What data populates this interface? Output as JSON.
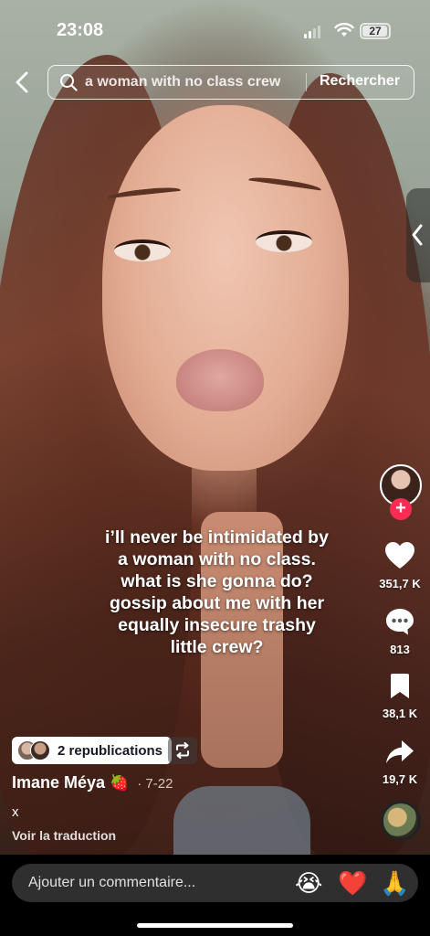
{
  "status_bar": {
    "time": "23:08",
    "battery": "27"
  },
  "search": {
    "query": "a woman with no class crew",
    "button_label": "Rechercher"
  },
  "video": {
    "caption_lines": [
      "i’ll never be intimidated by",
      "a woman with no class.",
      "what is she gonna do?",
      "gossip about me with her",
      "equally insecure trashy",
      "little crew?"
    ]
  },
  "actions": {
    "like_count": "351,7 K",
    "comment_count": "813",
    "save_count": "38,1 K",
    "share_count": "19,7 K",
    "like_color": "#ffffff",
    "follow_color": "#fe2c55"
  },
  "post": {
    "republications_label": "2 republications",
    "author": "Imane Méya",
    "author_emoji": "🍓",
    "date": "· 7-22",
    "description": "x",
    "translate_label": "Voir la traduction"
  },
  "comment_bar": {
    "placeholder": "Ajouter un commentaire...",
    "emojis": [
      "😭",
      "❤️",
      "🙏"
    ]
  },
  "icons": [
    "back-chevron-icon",
    "search-icon",
    "heart-icon",
    "comment-icon",
    "bookmark-icon",
    "share-icon",
    "repost-icon",
    "plus-icon",
    "panel-chevron-icon"
  ]
}
